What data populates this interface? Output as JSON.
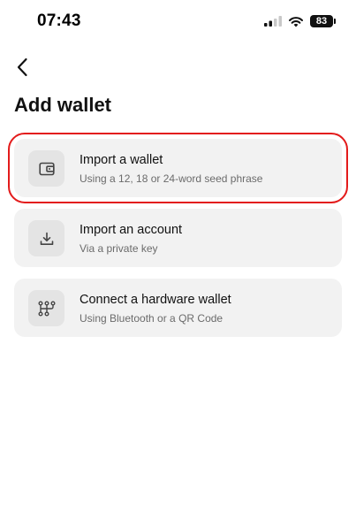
{
  "status_bar": {
    "time": "07:43",
    "battery": "83",
    "icons": [
      "signal-icon",
      "wifi-icon",
      "battery-icon"
    ]
  },
  "header": {
    "back_icon": "chevron-left-icon",
    "title": "Add wallet"
  },
  "options": [
    {
      "icon": "wallet-icon",
      "title": "Import a wallet",
      "subtitle": "Using a 12, 18 or 24-word seed phrase",
      "highlighted": true,
      "highlight_color": "#e31b1b"
    },
    {
      "icon": "download-icon",
      "title": "Import an account",
      "subtitle": "Via a private key",
      "highlighted": false
    },
    {
      "icon": "hardware-wallet-icon",
      "title": "Connect a hardware wallet",
      "subtitle": "Using Bluetooth or a QR Code",
      "highlighted": false
    }
  ],
  "colors": {
    "card_background": "#f2f2f2",
    "icon_box_background": "#e4e4e4",
    "subtitle_text": "#6b6b6b"
  }
}
